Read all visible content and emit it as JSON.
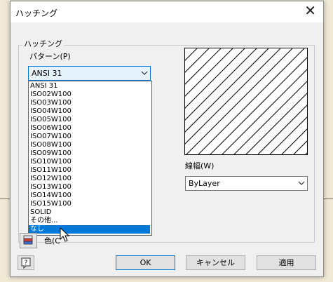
{
  "window": {
    "title": "ハッチング",
    "close_icon": "close-icon"
  },
  "group": {
    "label": "ハッチング"
  },
  "pattern": {
    "label": "パターン(P)",
    "selected": "ANSI 31",
    "options": [
      "ANSI 31",
      "ISO02W100",
      "ISO03W100",
      "ISO04W100",
      "ISO05W100",
      "ISO06W100",
      "ISO07W100",
      "ISO08W100",
      "ISO09W100",
      "ISO10W100",
      "ISO11W100",
      "ISO12W100",
      "ISO13W100",
      "ISO14W100",
      "ISO15W100",
      "SOLID",
      "その他...",
      "なし"
    ],
    "highlighted": "なし"
  },
  "lineweight": {
    "label": "線幅(W)",
    "selected": "ByLayer"
  },
  "color": {
    "label": "色(C",
    "icon": "layers-color-icon"
  },
  "buttons": {
    "ok": "OK",
    "cancel": "キャンセル",
    "apply": "適用",
    "help": "?"
  },
  "colors": {
    "accent": "#0078d7",
    "highlight_bg": "#0078d7",
    "combo_open_bg": "#e5f1fb"
  }
}
